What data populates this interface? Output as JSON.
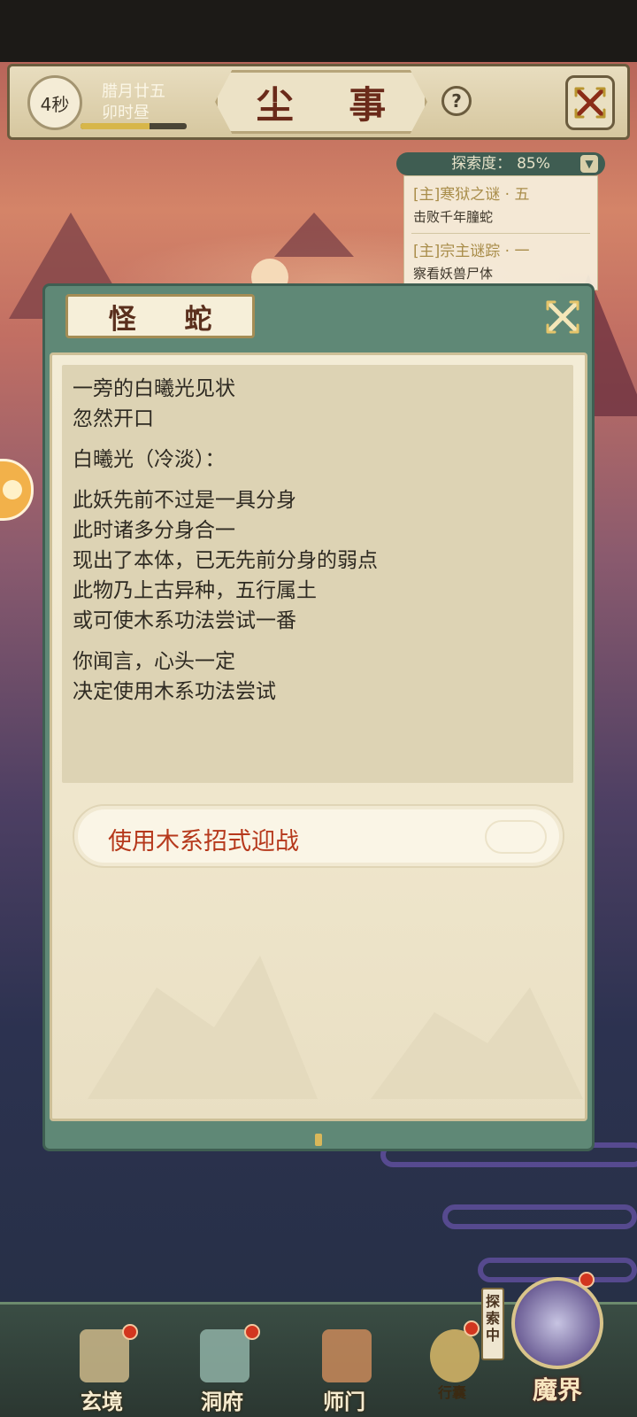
{
  "header": {
    "timer": "4秒",
    "date_line1": "腊月廿五",
    "date_line2": "卯时昼",
    "title": "尘 事",
    "help": "?"
  },
  "explore": {
    "label": "探索度：",
    "percent": "85%",
    "progress_fraction": 0.85,
    "quests": [
      {
        "title": "[主]寒狱之谜 · 五",
        "subtitle": "击败千年朣蛇"
      },
      {
        "title": "[主]宗主谜踪 · 一",
        "subtitle": "察看妖兽尸体"
      }
    ]
  },
  "dialog": {
    "title": "怪 蛇",
    "paragraphs": [
      [
        "一旁的白曦光见状",
        "忽然开口"
      ],
      [
        "白曦光（冷淡）："
      ],
      [
        "此妖先前不过是一具分身",
        "此时诸多分身合一",
        "现出了本体，已无先前分身的弱点",
        "此物乃上古异种，五行属土",
        "或可使木系功法尝试一番"
      ],
      [
        "你闻言，心头一定",
        "决定使用木系功法尝试"
      ]
    ],
    "choice": "使用木系招式迎战"
  },
  "bottom_nav": {
    "items": [
      "玄境",
      "洞府",
      "师门",
      "行囊"
    ],
    "explore_tag": "探索中",
    "demon_realm": "魔界"
  },
  "colors": {
    "accent_green": "#5f8876",
    "choice_red": "#b6391c",
    "badge_red": "#d2361f"
  }
}
